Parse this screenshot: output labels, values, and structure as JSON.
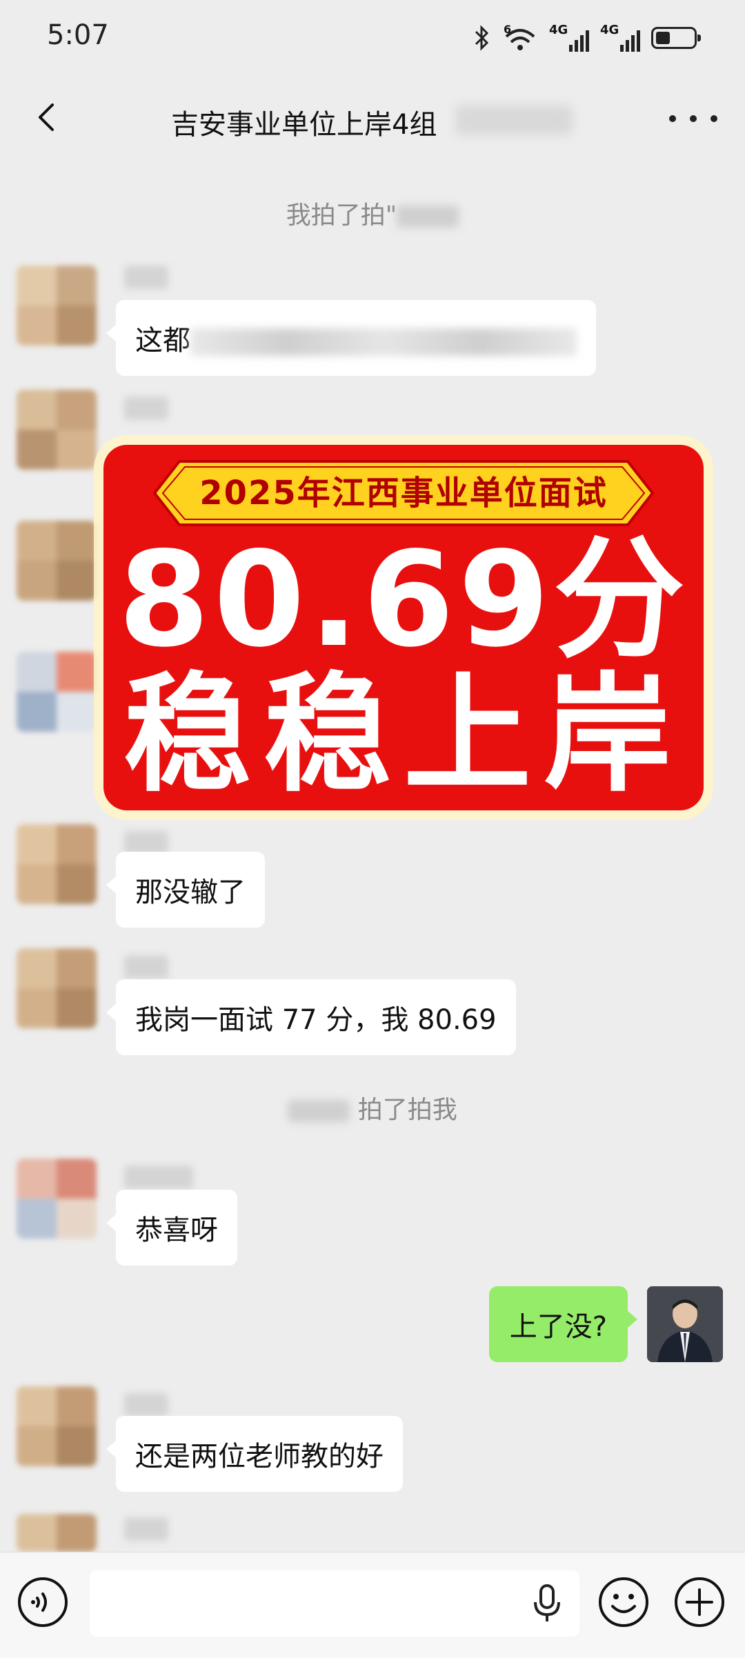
{
  "status_bar": {
    "time": "5:07",
    "signal1_label": "4G",
    "signal2_label": "4G",
    "wifi_label": "6"
  },
  "header": {
    "title": "吉安事业单位上岸4组"
  },
  "chat": {
    "system_messages": [
      {
        "text": "我拍了拍\""
      },
      {
        "text": "拍了拍我"
      }
    ],
    "incoming": [
      {
        "text": "这都"
      },
      {
        "text": "那没辙了"
      },
      {
        "text": "我岗一面试 77 分，我 80.69"
      },
      {
        "text": "恭喜呀"
      },
      {
        "text": "还是两位老师教的好"
      }
    ],
    "outgoing": [
      {
        "text": "上了没?"
      }
    ]
  },
  "banner": {
    "tag": "2025年江西事业单位面试",
    "score": "80.69分",
    "slogan": "稳稳上岸"
  },
  "input_bar": {
    "placeholder": ""
  },
  "colors": {
    "bubble_outgoing": "#95ec69",
    "banner_red": "#e8100f",
    "banner_yellow": "#ffd21f"
  }
}
